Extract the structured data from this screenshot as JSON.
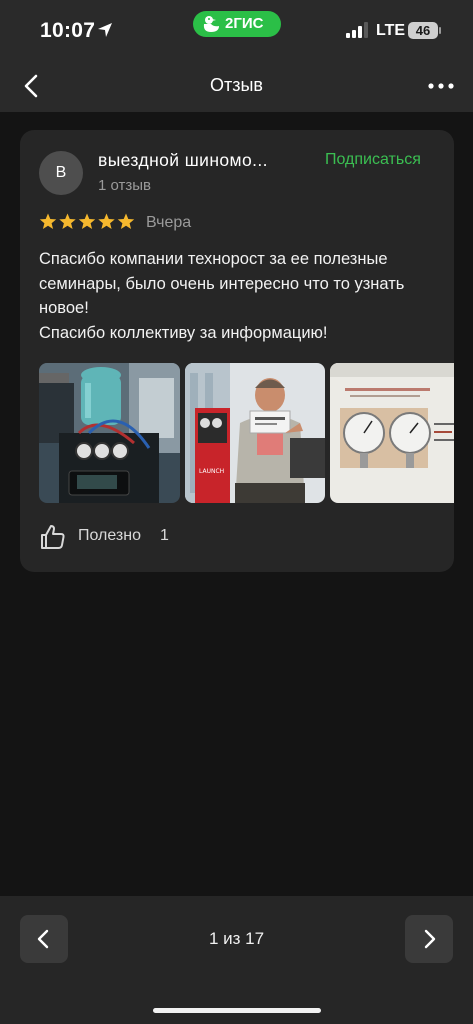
{
  "status_bar": {
    "time": "10:07",
    "app_badge": "2ГИС",
    "network": "LTE",
    "battery": "46"
  },
  "nav": {
    "title": "Отзыв",
    "back_icon": "chevron-left-icon",
    "more_icon": "more-dots-icon"
  },
  "review": {
    "avatar_letter": "В",
    "author_name": "выездной шиномо...",
    "author_reviews": "1 отзыв",
    "subscribe_label": "Подписаться",
    "rating": 5,
    "date": "Вчера",
    "text_lines": [
      "Спасибо компании технорост за ее полезные семинары, было очень интересно что то узнать новое!",
      "Спасибо коллективу за информацию!"
    ],
    "photos": [
      "photo-refrigerant-station",
      "photo-man-with-certificate",
      "photo-presentation-slide"
    ],
    "helpful_label": "Полезно",
    "helpful_count": "1"
  },
  "pager": {
    "text": "1 из 17",
    "prev_icon": "chevron-left-icon",
    "next_icon": "chevron-right-icon"
  },
  "colors": {
    "background": "#141414",
    "card": "#262626",
    "accent_green": "#3bbf52",
    "star": "#f5b82e",
    "brand_green": "#2bbf47"
  }
}
